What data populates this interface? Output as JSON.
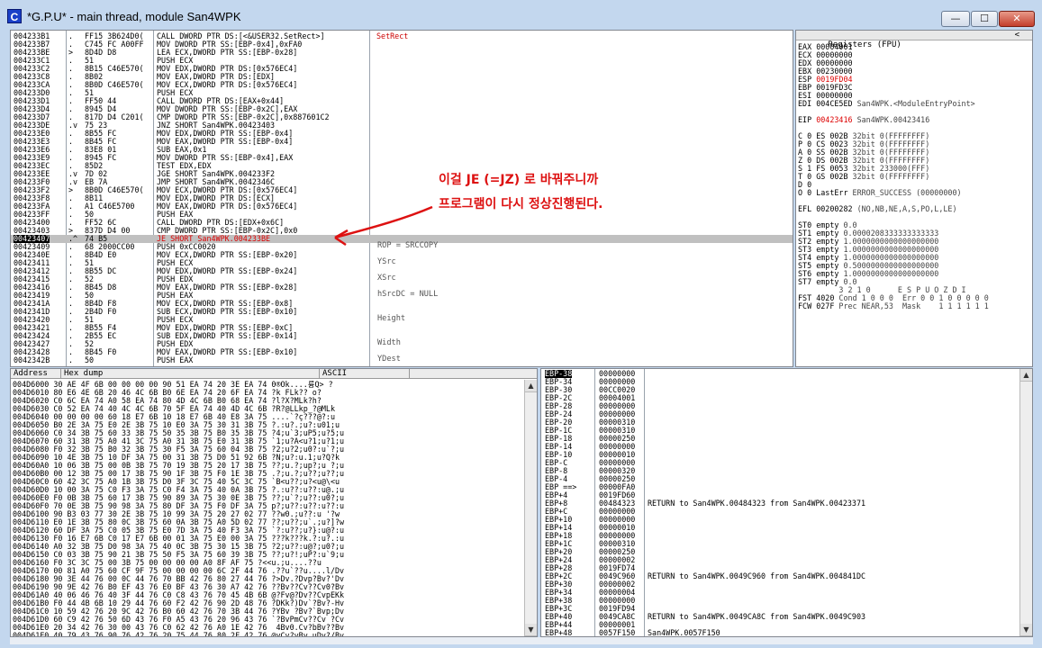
{
  "window": {
    "title": "*G.P.U* - main thread, module San4WPK",
    "icon_letter": "C",
    "minimize": "—",
    "maximize": "☐",
    "close": "✕"
  },
  "cpu": {
    "rows": [
      {
        "addr": "004233B1",
        "mark": ".",
        "hex": "FF15 3B624D0(",
        "dis": "CALL DWORD PTR DS:[<&USER32.SetRect>]",
        "com": "SetRect"
      },
      {
        "addr": "004233B7",
        "mark": ".",
        "hex": "C745 FC A00FF",
        "dis": "MOV DWORD PTR SS:[EBP-0x4],0xFA0",
        "com": ""
      },
      {
        "addr": "004233BE",
        "mark": ">",
        "hex": "8D4D D8",
        "dis": "LEA ECX,DWORD PTR SS:[EBP-0x28]",
        "com": ""
      },
      {
        "addr": "004233C1",
        "mark": ".",
        "hex": "51",
        "dis": "PUSH ECX",
        "com": ""
      },
      {
        "addr": "004233C2",
        "mark": ".",
        "hex": "8B15 C46E570(",
        "dis": "MOV EDX,DWORD PTR DS:[0x576EC4]",
        "com": ""
      },
      {
        "addr": "004233C8",
        "mark": ".",
        "hex": "8B02",
        "dis": "MOV EAX,DWORD PTR DS:[EDX]",
        "com": ""
      },
      {
        "addr": "004233CA",
        "mark": ".",
        "hex": "8B0D C46E570(",
        "dis": "MOV ECX,DWORD PTR DS:[0x576EC4]",
        "com": ""
      },
      {
        "addr": "004233D0",
        "mark": ".",
        "hex": "51",
        "dis": "PUSH ECX",
        "com": ""
      },
      {
        "addr": "004233D1",
        "mark": ".",
        "hex": "FF50 44",
        "dis": "CALL DWORD PTR DS:[EAX+0x44]",
        "com": ""
      },
      {
        "addr": "004233D4",
        "mark": ".",
        "hex": "8945 D4",
        "dis": "MOV DWORD PTR SS:[EBP-0x2C],EAX",
        "com": ""
      },
      {
        "addr": "004233D7",
        "mark": ".",
        "hex": "817D D4 C201(",
        "dis": "CMP DWORD PTR SS:[EBP-0x2C],0x887601C2",
        "com": ""
      },
      {
        "addr": "004233DE",
        "mark": ".v",
        "hex": "75 23",
        "dis": "JNZ SHORT San4WPK.00423403",
        "com": ""
      },
      {
        "addr": "004233E0",
        "mark": ".",
        "hex": "8B55 FC",
        "dis": "MOV EDX,DWORD PTR SS:[EBP-0x4]",
        "com": ""
      },
      {
        "addr": "004233E3",
        "mark": ".",
        "hex": "8B45 FC",
        "dis": "MOV EAX,DWORD PTR SS:[EBP-0x4]",
        "com": ""
      },
      {
        "addr": "004233E6",
        "mark": ".",
        "hex": "83E8 01",
        "dis": "SUB EAX,0x1",
        "com": ""
      },
      {
        "addr": "004233E9",
        "mark": ".",
        "hex": "8945 FC",
        "dis": "MOV DWORD PTR SS:[EBP-0x4],EAX",
        "com": ""
      },
      {
        "addr": "004233EC",
        "mark": ".",
        "hex": "85D2",
        "dis": "TEST EDX,EDX",
        "com": ""
      },
      {
        "addr": "004233EE",
        "mark": ".v",
        "hex": "7D 02",
        "dis": "JGE SHORT San4WPK.004233F2",
        "com": ""
      },
      {
        "addr": "004233F0",
        "mark": ".v",
        "hex": "EB 7A",
        "dis": "JMP SHORT San4WPK.0042346C",
        "com": ""
      },
      {
        "addr": "004233F2",
        "mark": ">",
        "hex": "8B0D C46E570(",
        "dis": "MOV ECX,DWORD PTR DS:[0x576EC4]",
        "com": ""
      },
      {
        "addr": "004233F8",
        "mark": ".",
        "hex": "8B11",
        "dis": "MOV EDX,DWORD PTR DS:[ECX]",
        "com": ""
      },
      {
        "addr": "004233FA",
        "mark": ".",
        "hex": "A1 C46E5700",
        "dis": "MOV EAX,DWORD PTR DS:[0x576EC4]",
        "com": ""
      },
      {
        "addr": "004233FF",
        "mark": ".",
        "hex": "50",
        "dis": "PUSH EAX",
        "com": ""
      },
      {
        "addr": "00423400",
        "mark": ".",
        "hex": "FF52 6C",
        "dis": "CALL DWORD PTR DS:[EDX+0x6C]",
        "com": ""
      },
      {
        "addr": "00423403",
        "mark": ">",
        "hex": "837D D4 00",
        "dis": "CMP DWORD PTR SS:[EBP-0x2C],0x0",
        "com": ""
      },
      {
        "addr": "00423407",
        "mark": ".^",
        "hex": "74 B5",
        "dis": "JE SHORT San4WPK.004233BE",
        "com": ""
      },
      {
        "addr": "00423409",
        "mark": ".",
        "hex": "68 2000CC00",
        "dis": "PUSH 0xCC0020",
        "com": ""
      },
      {
        "addr": "0042340E",
        "mark": ".",
        "hex": "8B4D E0",
        "dis": "MOV ECX,DWORD PTR SS:[EBP-0x20]",
        "com": ""
      },
      {
        "addr": "00423411",
        "mark": ".",
        "hex": "51",
        "dis": "PUSH ECX",
        "com": ""
      },
      {
        "addr": "00423412",
        "mark": ".",
        "hex": "8B55 DC",
        "dis": "MOV EDX,DWORD PTR SS:[EBP-0x24]",
        "com": ""
      },
      {
        "addr": "00423415",
        "mark": ".",
        "hex": "52",
        "dis": "PUSH EDX",
        "com": ""
      },
      {
        "addr": "00423416",
        "mark": ".",
        "hex": "8B45 D8",
        "dis": "MOV EAX,DWORD PTR SS:[EBP-0x28]",
        "com": ""
      },
      {
        "addr": "00423419",
        "mark": ".",
        "hex": "50",
        "dis": "PUSH EAX",
        "com": ""
      },
      {
        "addr": "0042341A",
        "mark": ".",
        "hex": "8B4D F8",
        "dis": "MOV ECX,DWORD PTR SS:[EBP-0x8]",
        "com": ""
      },
      {
        "addr": "0042341D",
        "mark": ".",
        "hex": "2B4D F0",
        "dis": "SUB ECX,DWORD PTR SS:[EBP-0x10]",
        "com": ""
      },
      {
        "addr": "00423420",
        "mark": ".",
        "hex": "51",
        "dis": "PUSH ECX",
        "com": ""
      },
      {
        "addr": "00423421",
        "mark": ".",
        "hex": "8B55 F4",
        "dis": "MOV EDX,DWORD PTR SS:[EBP-0xC]",
        "com": ""
      },
      {
        "addr": "00423424",
        "mark": ".",
        "hex": "2B55 EC",
        "dis": "SUB EDX,DWORD PTR SS:[EBP-0x14]",
        "com": ""
      },
      {
        "addr": "00423427",
        "mark": ".",
        "hex": "52",
        "dis": "PUSH EDX",
        "com": ""
      },
      {
        "addr": "00423428",
        "mark": ".",
        "hex": "8B45 F0",
        "dis": "MOV EAX,DWORD PTR SS:[EBP-0x10]",
        "com": ""
      },
      {
        "addr": "0042342B",
        "mark": ".",
        "hex": "50",
        "dis": "PUSH EAX",
        "com": ""
      }
    ],
    "selected_index": 25,
    "call_info": [
      "ROP = SRCCOPY",
      "YSrc",
      "XSrc",
      "hSrcDC = NULL",
      "Height",
      "Width",
      "YDest"
    ]
  },
  "registers": {
    "header": "Registers (FPU)",
    "collapse": "<",
    "lines": [
      {
        "n": "EAX",
        "v": "00004001",
        "x": "",
        "hi": false
      },
      {
        "n": "ECX",
        "v": "00000000",
        "x": "",
        "hi": false
      },
      {
        "n": "EDX",
        "v": "00000000",
        "x": "",
        "hi": false
      },
      {
        "n": "EBX",
        "v": "00230000",
        "x": "",
        "hi": false
      },
      {
        "n": "ESP",
        "v": "0019FD04",
        "x": "",
        "hi": true
      },
      {
        "n": "EBP",
        "v": "0019FD3C",
        "x": "",
        "hi": false
      },
      {
        "n": "ESI",
        "v": "00000000",
        "x": "",
        "hi": false
      },
      {
        "n": "EDI",
        "v": "004CE5ED",
        "x": "San4WPK.<ModuleEntryPoint>",
        "hi": false
      },
      {
        "n": "",
        "v": "",
        "x": "",
        "hi": false
      },
      {
        "n": "EIP",
        "v": "00423416",
        "x": "San4WPK.00423416",
        "hi": true
      },
      {
        "n": "",
        "v": "",
        "x": "",
        "hi": false
      },
      {
        "n": "C 0",
        "v": "ES 002B",
        "x": "32bit 0(FFFFFFFF)",
        "hi": false
      },
      {
        "n": "P 0",
        "v": "CS 0023",
        "x": "32bit 0(FFFFFFFF)",
        "hi": false
      },
      {
        "n": "A 0",
        "v": "SS 002B",
        "x": "32bit 0(FFFFFFFF)",
        "hi": false
      },
      {
        "n": "Z 0",
        "v": "DS 002B",
        "x": "32bit 0(FFFFFFFF)",
        "hi": false
      },
      {
        "n": "S 1",
        "v": "FS 0053",
        "x": "32bit 233000(FFF)",
        "hi": false
      },
      {
        "n": "T 0",
        "v": "GS 002B",
        "x": "32bit 0(FFFFFFFF)",
        "hi": false
      },
      {
        "n": "D 0",
        "v": "",
        "x": "",
        "hi": false
      },
      {
        "n": "O 0",
        "v": "LastErr",
        "x": "ERROR_SUCCESS (00000000)",
        "hi": false
      },
      {
        "n": "",
        "v": "",
        "x": "",
        "hi": false
      },
      {
        "n": "EFL",
        "v": "00200282",
        "x": "(NO,NB,NE,A,S,PO,L,LE)",
        "hi": false
      },
      {
        "n": "",
        "v": "",
        "x": "",
        "hi": false
      },
      {
        "n": "ST0",
        "v": "empty",
        "x": "0.0",
        "hi": false
      },
      {
        "n": "ST1",
        "v": "empty",
        "x": "0.0000208333333333333",
        "hi": false
      },
      {
        "n": "ST2",
        "v": "empty",
        "x": "1.0000000000000000000",
        "hi": false
      },
      {
        "n": "ST3",
        "v": "empty",
        "x": "1.0000000000000000000",
        "hi": false
      },
      {
        "n": "ST4",
        "v": "empty",
        "x": "1.0000000000000000000",
        "hi": false
      },
      {
        "n": "ST5",
        "v": "empty",
        "x": "0.5000000000000000000",
        "hi": false
      },
      {
        "n": "ST6",
        "v": "empty",
        "x": "1.0000000000000000000",
        "hi": false
      },
      {
        "n": "ST7",
        "v": "empty",
        "x": "0.0",
        "hi": false
      },
      {
        "n": "",
        "v": "",
        "x": "       3 2 1 0      E S P U O Z D I",
        "hi": false
      },
      {
        "n": "FST",
        "v": "4020",
        "x": "Cond 1 0 0 0  Err 0 0 1 0 0 0 0 0",
        "hi": false
      },
      {
        "n": "FCW",
        "v": "027F",
        "x": "Prec NEAR,53  Mask    1 1 1 1 1 1",
        "hi": false
      }
    ]
  },
  "dump": {
    "col_address": "Address",
    "col_hex": "Hex dump",
    "col_ascii": "ASCII",
    "rows": [
      "004D6000 30 AE 4F 6B 00 00 00 00 90 51 EA 74 20 3E EA 74 0®Ok....륭Q> ?",
      "004D6010 80 E6 4E 6B 20 46 4C 6B B0 6E EA 74 20 6F EA 74 ?k FLk?? o?",
      "004D6020 C0 6C EA 74 A0 58 EA 74 80 4D 4C 6B B0 68 EA 74 ?l?X?MLk?h?",
      "004D6030 C0 52 EA 74 40 4C 4C 6B 70 5F EA 74 40 4D 4C 6B ?R?@LLkp_?@MLk",
      "004D6040 00 00 00 00 60 18 E7 6B 10 18 E7 6B 40 E8 3A 75 ....`?ç???@?:u",
      "004D6050 B0 2E 3A 75 E0 2E 3B 75 10 E0 3A 75 30 31 3B 75 ?.:u?.;u?:u01;u",
      "004D6060 C0 34 3B 75 60 33 3B 75 50 35 3B 75 B0 35 3B 75 ?4;u`3;uP5;u?5;u",
      "004D6070 60 31 3B 75 A0 41 3C 75 A0 31 3B 75 E0 31 3B 75 `1;u?A<u?1;u?1;u",
      "004D6080 F0 32 3B 75 B0 32 3B 75 30 F5 3A 75 60 04 3B 75 ?2;u?2;u0?:u`?;u",
      "004D6090 10 4E 3B 75 10 DF 3A 75 00 31 3B 75 D0 51 92 6B ?N;u?:u.1;u?Q?k",
      "004D60A0 10 06 3B 75 00 0B 3B 75 70 19 3B 75 20 17 3B 75 ??;u.?;up?;u ?;u",
      "004D60B0 00 12 3B 75 00 17 3B 75 90 1F 3B 75 F0 1E 3B 75 .?;u.?;u??;u??;u",
      "004D60C0 60 42 3C 75 A0 1B 3B 75 D0 3F 3C 75 40 5C 3C 75 `B<u??;u?<u@\\<u",
      "004D60D0 10 00 3A 75 C0 F3 3A 75 C0 F4 3A 75 40 0A 3B 75 ?.:u??:u??:u@.;u",
      "004D60E0 F0 0B 3B 75 60 17 3B 75 90 89 3A 75 30 0E 3B 75 ??;u`?;u??:u0?;u",
      "004D60F0 70 0E 3B 75 90 98 3A 75 80 DF 3A 75 F0 DF 3A 75 p?;u??:u??:u??:u",
      "004D6100 90 B3 03 77 30 2E 3B 75 10 99 3A 75 20 27 02 77 ??w0.;u??:u '?w",
      "004D6110 E0 1E 3B 75 80 0C 3B 75 60 0A 3B 75 A0 5D 02 77 ??;u??;u`.;u?]?w",
      "004D6120 60 DF 3A 75 C0 05 3B 75 E0 7D 3A 75 40 F3 3A 75 `?:u??;u?}:u@?:u",
      "004D6130 F0 16 E7 6B C0 17 E7 6B 00 01 3A 75 E0 00 3A 75 ???k???k.?:u?.:u",
      "004D6140 A0 32 3B 75 D0 98 3A 75 40 0C 3B 75 30 15 3B 75 ?2;u??:u@?;u0?;u",
      "004D6150 C0 03 3B 75 90 21 3B 75 50 F5 3A 75 60 39 3B 75 ??;u?!;uP?:u`9;u",
      "004D6160 F0 3C 3C 75 00 3B 75 00 00 00 00 A0 8F AF 75 ?<<u.;u....??u",
      "004D6170 00 81 A0 75 60 CF 9F 75 00 00 00 00 6C 2F 44 76 .??u`??u....l/Dv",
      "004D6180 90 3E 44 76 00 0C 44 76 70 BB 42 76 80 27 44 76 ?>Dv.?Dvp?Bv?'Dv",
      "004D6190 90 9E 42 76 B0 EF 43 76 E0 BF 43 76 30 A7 42 76 ??Bv??Cv??Cv0?Bv",
      "004D61A0 40 06 46 76 40 3F 44 76 C0 C8 43 76 70 45 4B 6B @?Fv@?Dv??CvpEKk",
      "004D61B0 F0 44 4B 6B 10 29 44 76 60 F2 42 76 90 2D 48 76 ?DKk?)Dv`?Bv?-Hv",
      "004D61C0 10 59 42 76 20 9C 42 76 B0 60 42 76 70 3B 44 76 ?YBv ?Bv?`Bvp;Dv",
      "004D61D0 60 C9 42 76 50 6D 43 76 F0 A5 43 76 20 96 43 76 `?BvPmCv??Cv ?Cv",
      "004D61E0 20 34 42 76 30 00 43 76 C0 62 42 76 A0 1E 42 76  4Bv0.Cv?bBv??Bv",
      "004D61F0 40 79 43 76 90 76 42 76 20 75 44 76 80 2F 42 76 @yCv?vBv uDv?/Bv"
    ]
  },
  "stack": {
    "rows": [
      {
        "l": "EBP-38",
        "v": "00000000",
        "c": "",
        "cur": true
      },
      {
        "l": "EBP-34",
        "v": "00000000",
        "c": "",
        "cur": false
      },
      {
        "l": "EBP-30",
        "v": "00CC0020",
        "c": "",
        "cur": false
      },
      {
        "l": "EBP-2C",
        "v": "00004001",
        "c": "",
        "cur": false
      },
      {
        "l": "EBP-28",
        "v": "00000000",
        "c": "",
        "cur": false
      },
      {
        "l": "EBP-24",
        "v": "00000000",
        "c": "",
        "cur": false
      },
      {
        "l": "EBP-20",
        "v": "00000310",
        "c": "",
        "cur": false
      },
      {
        "l": "EBP-1C",
        "v": "00000310",
        "c": "",
        "cur": false
      },
      {
        "l": "EBP-18",
        "v": "00000250",
        "c": "",
        "cur": false
      },
      {
        "l": "EBP-14",
        "v": "00000000",
        "c": "",
        "cur": false
      },
      {
        "l": "EBP-10",
        "v": "00000010",
        "c": "",
        "cur": false
      },
      {
        "l": "EBP-C",
        "v": "00000000",
        "c": "",
        "cur": false
      },
      {
        "l": "EBP-8",
        "v": "00000320",
        "c": "",
        "cur": false
      },
      {
        "l": "EBP-4",
        "v": "00000250",
        "c": "",
        "cur": false
      },
      {
        "l": "EBP ==>",
        "v": "00000FA0",
        "c": "",
        "cur": false
      },
      {
        "l": "EBP+4",
        "v": "0019FD60",
        "c": "",
        "cur": false
      },
      {
        "l": "EBP+8",
        "v": "00484323",
        "c": "RETURN to San4WPK.00484323 from San4WPK.00423371",
        "cur": false
      },
      {
        "l": "EBP+C",
        "v": "00000000",
        "c": "",
        "cur": false
      },
      {
        "l": "EBP+10",
        "v": "00000000",
        "c": "",
        "cur": false
      },
      {
        "l": "EBP+14",
        "v": "00000010",
        "c": "",
        "cur": false
      },
      {
        "l": "EBP+18",
        "v": "00000000",
        "c": "",
        "cur": false
      },
      {
        "l": "EBP+1C",
        "v": "00000310",
        "c": "",
        "cur": false
      },
      {
        "l": "EBP+20",
        "v": "00000250",
        "c": "",
        "cur": false
      },
      {
        "l": "EBP+24",
        "v": "00000002",
        "c": "",
        "cur": false
      },
      {
        "l": "EBP+28",
        "v": "0019FD74",
        "c": "",
        "cur": false
      },
      {
        "l": "EBP+2C",
        "v": "0049C960",
        "c": "RETURN to San4WPK.0049C960 from San4WPK.004841DC",
        "cur": false
      },
      {
        "l": "EBP+30",
        "v": "00000002",
        "c": "",
        "cur": false
      },
      {
        "l": "EBP+34",
        "v": "00000004",
        "c": "",
        "cur": false
      },
      {
        "l": "EBP+38",
        "v": "00000000",
        "c": "",
        "cur": false
      },
      {
        "l": "EBP+3C",
        "v": "0019FD94",
        "c": "",
        "cur": false
      },
      {
        "l": "EBP+40",
        "v": "0049CA8C",
        "c": "RETURN to San4WPK.0049CA8C from San4WPK.0049C903",
        "cur": false
      },
      {
        "l": "EBP+44",
        "v": "00000001",
        "c": "",
        "cur": false
      },
      {
        "l": "EBP+48",
        "v": "0057F150",
        "c": "San4WPK.0057F150",
        "cur": false
      }
    ]
  },
  "annotation": {
    "line1": "이걸 JE (=JZ) 로 바꿔주니까",
    "line2": "프로그램이 다시 정상진행된다.",
    "color": "#d11111"
  },
  "colors": {
    "selected_row": "#c0c0c0",
    "highlight": "#d00000",
    "titlebar": "#c3d7ee"
  }
}
